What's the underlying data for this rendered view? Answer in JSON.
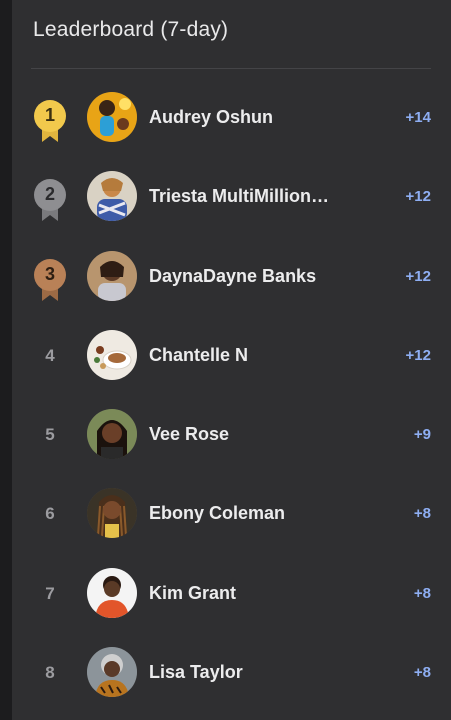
{
  "leaderboard": {
    "title": "Leaderboard (7-day)",
    "entries": [
      {
        "rank": "1",
        "name": "Audrey Oshun",
        "score": "+14",
        "medal": "gold"
      },
      {
        "rank": "2",
        "name": "Triesta MultiMillion…",
        "score": "+12",
        "medal": "silver"
      },
      {
        "rank": "3",
        "name": "DaynaDayne Banks",
        "score": "+12",
        "medal": "bronze"
      },
      {
        "rank": "4",
        "name": "Chantelle N",
        "score": "+12"
      },
      {
        "rank": "5",
        "name": "Vee Rose",
        "score": "+9"
      },
      {
        "rank": "6",
        "name": "Ebony Coleman",
        "score": "+8"
      },
      {
        "rank": "7",
        "name": "Kim Grant",
        "score": "+8"
      },
      {
        "rank": "8",
        "name": "Lisa Taylor",
        "score": "+8"
      }
    ]
  },
  "colors": {
    "background": "#2f2f31",
    "score": "#8eaef2",
    "gold": "#f2c94c",
    "silver": "#8e8e91",
    "bronze": "#b98157"
  }
}
